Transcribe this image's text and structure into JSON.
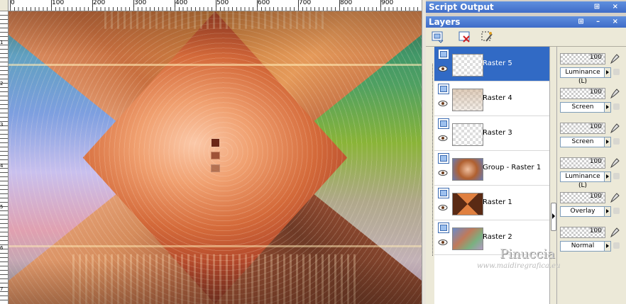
{
  "ruler": {
    "labels": [
      "0",
      "100",
      "200",
      "300",
      "400",
      "500",
      "600",
      "700",
      "800",
      "900"
    ],
    "vlabels": [
      "1",
      "2",
      "3",
      "4",
      "5",
      "6",
      "7",
      "8",
      "9"
    ]
  },
  "panels": {
    "script_output": {
      "title": "Script Output"
    },
    "layers": {
      "title": "Layers"
    }
  },
  "toolbar": {
    "icons": [
      "new-raster-layer-icon",
      "delete-layer-icon",
      "new-mask-layer-icon"
    ]
  },
  "layers": [
    {
      "name": "Raster 5",
      "selected": true,
      "opacity": "100",
      "blend": "Luminance (L)"
    },
    {
      "name": "Raster 4",
      "selected": false,
      "opacity": "100",
      "blend": "Screen"
    },
    {
      "name": "Raster 3",
      "selected": false,
      "opacity": "100",
      "blend": "Screen"
    },
    {
      "name": "Group - Raster 1",
      "selected": false,
      "opacity": "100",
      "blend": "Luminance (L)"
    },
    {
      "name": "Raster 1",
      "selected": false,
      "opacity": "100",
      "blend": "Overlay"
    },
    {
      "name": "Raster 2",
      "selected": false,
      "opacity": "100",
      "blend": "Normal"
    }
  ],
  "watermark": {
    "name": "Pinuccia",
    "url": "www.maidiregrafica.eu"
  },
  "colors": {
    "selection": "#316ac5",
    "panel_header": "#4a78d0"
  }
}
